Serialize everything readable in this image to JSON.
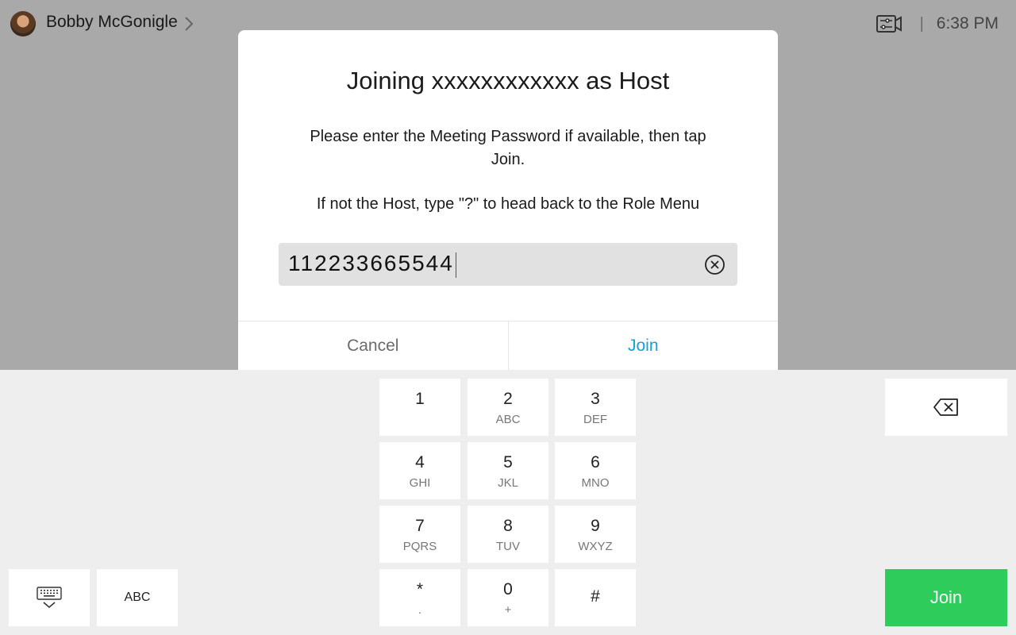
{
  "user": {
    "name": "Bobby McGonigle"
  },
  "status": {
    "time": "6:38 PM",
    "separator": "|"
  },
  "dialog": {
    "title": "Joining xxxxxxxxxxxx as Host",
    "message": "Please enter the Meeting Password if available, then tap Join.",
    "hint": "If not the Host, type \"?\" to head back to the Role Menu",
    "password_value": "112233665544",
    "cancel_label": "Cancel",
    "join_label": "Join"
  },
  "keypad": {
    "keys": [
      {
        "digit": "1",
        "letters": ""
      },
      {
        "digit": "2",
        "letters": "ABC"
      },
      {
        "digit": "3",
        "letters": "DEF"
      },
      {
        "digit": "4",
        "letters": "GHI"
      },
      {
        "digit": "5",
        "letters": "JKL"
      },
      {
        "digit": "6",
        "letters": "MNO"
      },
      {
        "digit": "7",
        "letters": "PQRS"
      },
      {
        "digit": "8",
        "letters": "TUV"
      },
      {
        "digit": "9",
        "letters": "WXYZ"
      },
      {
        "digit": "*",
        "letters": "."
      },
      {
        "digit": "0",
        "letters": "+"
      },
      {
        "digit": "#",
        "letters": ""
      }
    ],
    "abc_label": "ABC",
    "join_label": "Join"
  },
  "icons": {
    "chevron": "chevron-right-icon",
    "camera_controls": "camera-controls-icon",
    "clear": "clear-input-icon",
    "backspace": "backspace-icon",
    "keyboard": "keyboard-hide-icon"
  },
  "colors": {
    "overlay": "#a9a9a9",
    "join_text": "#0fa4d6",
    "join_button": "#2ecc5a",
    "keypad_bg": "#eeeeee"
  }
}
